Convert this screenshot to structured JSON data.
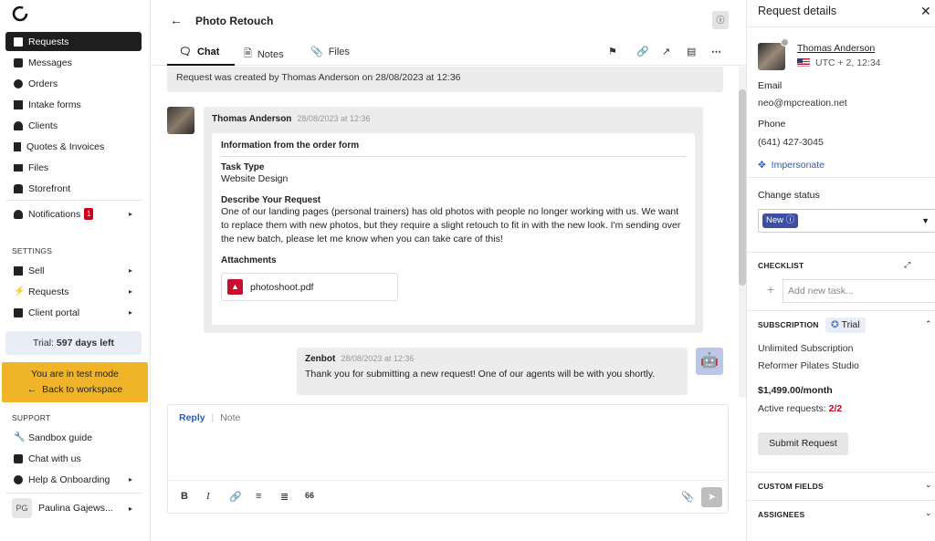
{
  "sidebar": {
    "nav": [
      {
        "label": "Requests",
        "icon": "requests-icon"
      },
      {
        "label": "Messages",
        "icon": "messages-icon"
      },
      {
        "label": "Orders",
        "icon": "orders-icon"
      },
      {
        "label": "Intake forms",
        "icon": "intake-forms-icon"
      },
      {
        "label": "Clients",
        "icon": "clients-icon"
      },
      {
        "label": "Quotes & Invoices",
        "icon": "quotes-invoices-icon"
      },
      {
        "label": "Files",
        "icon": "files-icon"
      },
      {
        "label": "Storefront",
        "icon": "storefront-icon"
      }
    ],
    "notifications": {
      "label": "Notifications",
      "count": "1"
    },
    "settings_title": "SETTINGS",
    "settings": [
      {
        "label": "Sell"
      },
      {
        "label": "Requests"
      },
      {
        "label": "Client portal"
      }
    ],
    "trial": {
      "prefix": "Trial: ",
      "days": "597 days left"
    },
    "test_mode": {
      "text": "You are in test mode",
      "back": "Back to workspace"
    },
    "support_title": "SUPPORT",
    "support": [
      {
        "label": "Sandbox guide"
      },
      {
        "label": "Chat with us"
      },
      {
        "label": "Help & Onboarding"
      }
    ],
    "user": {
      "initials": "PG",
      "name": "Paulina Gajews..."
    }
  },
  "header": {
    "title": "Photo Retouch",
    "tabs": [
      {
        "label": "Chat"
      },
      {
        "label": "Notes"
      },
      {
        "label": "Files"
      }
    ]
  },
  "chat": {
    "system_message": "Request was created by Thomas Anderson on 28/08/2023 at 12:36",
    "message1": {
      "author": "Thomas Anderson",
      "date": "28/08/2023 at 12:36",
      "card_title": "Information from the order form",
      "task_type_label": "Task Type",
      "task_type_value": "Website Design",
      "describe_label": "Describe Your Request",
      "describe_value": "One of our landing pages (personal trainers) has old photos with people no longer working with us. We want to replace them with new photos, but they require a slight retouch to fit in with the new look. I'm sending over the new batch, please let me know when you can take care of this!",
      "attachments_label": "Attachments",
      "attachment": "photoshoot.pdf"
    },
    "message2": {
      "author": "Zenbot",
      "date": "28/08/2023 at 12:36",
      "text": "Thank you for submitting a new request! One of our agents will be with you shortly."
    }
  },
  "composer": {
    "reply": "Reply",
    "divider": "|",
    "note": "Note",
    "quote": "66"
  },
  "details": {
    "title": "Request details",
    "client_name": "Thomas Anderson",
    "timezone": "UTC + 2, 12:34",
    "email_label": "Email",
    "email": "neo@mpcreation.net",
    "phone_label": "Phone",
    "phone": "(641) 427-3045",
    "impersonate": "Impersonate",
    "change_status_label": "Change status",
    "status": "New",
    "checklist_label": "CHECKLIST",
    "add_task_placeholder": "Add new task...",
    "subscription_label": "SUBSCRIPTION",
    "subscription_status": "Trial",
    "subscription_name": "Unlimited Subscription",
    "subscription_company": "Reformer Pilates Studio",
    "price": "$1,499.00/month",
    "active_requests_label": "Active requests: ",
    "active_requests": "2/2",
    "submit": "Submit Request",
    "custom_fields_label": "CUSTOM FIELDS",
    "assignees_label": "ASSIGNEES"
  }
}
